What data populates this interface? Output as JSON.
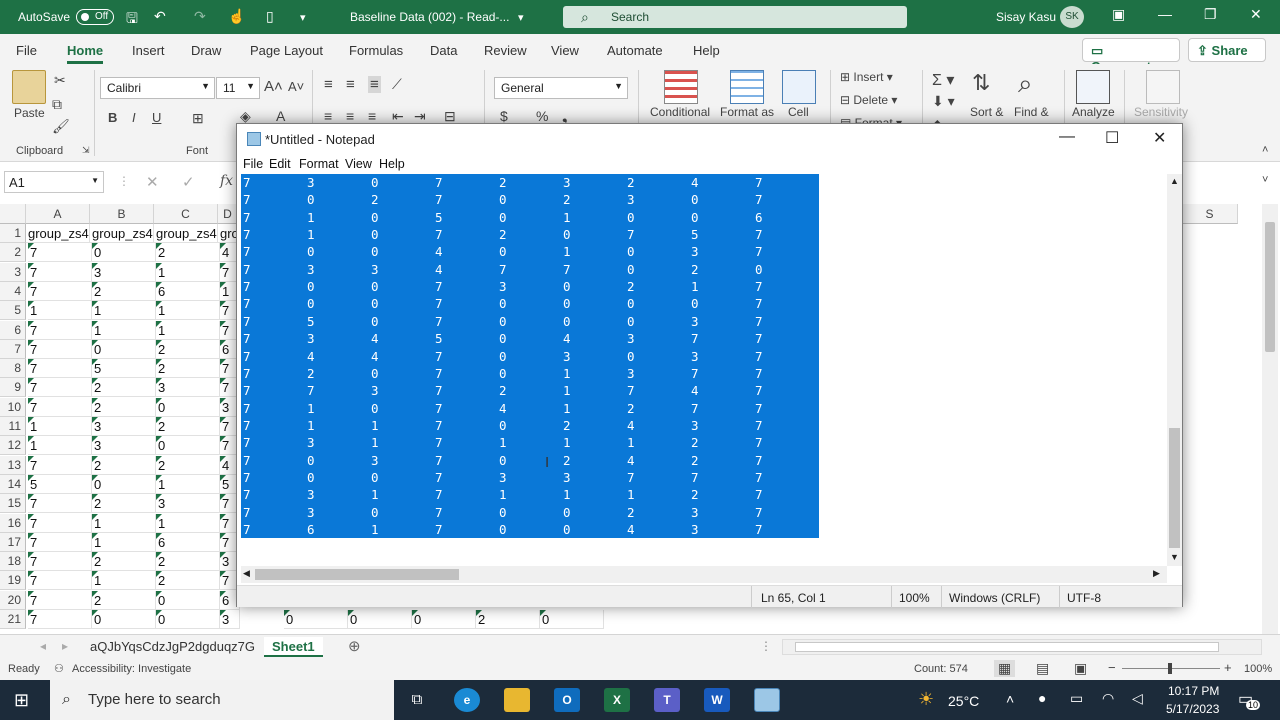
{
  "excel": {
    "autosave_label": "AutoSave",
    "autosave_state": "Off",
    "file_title": "Baseline Data (002)  -  Read-...",
    "search_placeholder": "Search",
    "user_name": "Sisay Kasu",
    "user_initials": "SK",
    "menu": [
      "File",
      "Home",
      "Insert",
      "Draw",
      "Page Layout",
      "Formulas",
      "Data",
      "Review",
      "View",
      "Automate",
      "Help"
    ],
    "active_menu": "Home",
    "comments_label": "Comments",
    "share_label": "Share",
    "ribbon": {
      "paste_label": "Paste",
      "clipboard_label": "Clipboard",
      "font_name": "Calibri",
      "font_size": "11",
      "font_group_label": "Font",
      "number_format": "General",
      "conditional_label": "Conditional",
      "format_as_label": "Format as",
      "cell_label": "Cell",
      "insert_label": "Insert",
      "delete_label": "Delete",
      "format_label": "Format",
      "sort_label": "Sort &",
      "find_label": "Find &",
      "analyze_label": "Analyze",
      "sensitivity_label": "Sensitivity"
    },
    "name_box": "A1",
    "fx_label": "fx",
    "columns": [
      "A",
      "B",
      "C",
      "D"
    ],
    "right_column": "S",
    "rows": [
      [
        "group_zs4",
        "group_zs4",
        "group_zs4",
        "gro"
      ],
      [
        "7",
        "0",
        "2",
        "4"
      ],
      [
        "7",
        "3",
        "1",
        "7"
      ],
      [
        "7",
        "2",
        "6",
        "1"
      ],
      [
        "1",
        "1",
        "1",
        "7"
      ],
      [
        "7",
        "1",
        "1",
        "7"
      ],
      [
        "7",
        "0",
        "2",
        "6"
      ],
      [
        "7",
        "5",
        "2",
        "7"
      ],
      [
        "7",
        "2",
        "3",
        "7"
      ],
      [
        "7",
        "2",
        "0",
        "3"
      ],
      [
        "1",
        "3",
        "2",
        "7"
      ],
      [
        "1",
        "3",
        "0",
        "7"
      ],
      [
        "7",
        "2",
        "2",
        "4"
      ],
      [
        "5",
        "0",
        "1",
        "5"
      ],
      [
        "7",
        "2",
        "3",
        "7"
      ],
      [
        "7",
        "1",
        "1",
        "7"
      ],
      [
        "7",
        "1",
        "6",
        "7"
      ],
      [
        "7",
        "2",
        "2",
        "3"
      ],
      [
        "7",
        "1",
        "2",
        "7"
      ],
      [
        "7",
        "2",
        "0",
        "6"
      ],
      [
        "7",
        "0",
        "0",
        "3"
      ]
    ],
    "row21_extra": [
      "0",
      "0",
      "0",
      "2",
      "0"
    ],
    "sheet_tabs": [
      "aQJbYqsCdzJgP2dgduqz7G",
      "Sheet1"
    ],
    "active_sheet": "Sheet1",
    "status_ready": "Ready",
    "status_accessibility": "Accessibility: Investigate",
    "status_count": "Count: 574",
    "zoom": "100%"
  },
  "notepad": {
    "title": "*Untitled - Notepad",
    "menu": [
      "File",
      "Edit",
      "Format",
      "View",
      "Help"
    ],
    "rows": [
      [
        "7",
        "3",
        "0",
        "7",
        "2",
        "3",
        "2",
        "4",
        "7"
      ],
      [
        "7",
        "0",
        "2",
        "7",
        "0",
        "2",
        "3",
        "0",
        "7"
      ],
      [
        "7",
        "1",
        "0",
        "5",
        "0",
        "1",
        "0",
        "0",
        "6"
      ],
      [
        "7",
        "1",
        "0",
        "7",
        "2",
        "0",
        "7",
        "5",
        "7"
      ],
      [
        "7",
        "0",
        "0",
        "4",
        "0",
        "1",
        "0",
        "3",
        "7"
      ],
      [
        "7",
        "3",
        "3",
        "4",
        "7",
        "7",
        "0",
        "2",
        "0"
      ],
      [
        "7",
        "0",
        "0",
        "7",
        "3",
        "0",
        "2",
        "1",
        "7"
      ],
      [
        "7",
        "0",
        "0",
        "7",
        "0",
        "0",
        "0",
        "0",
        "7"
      ],
      [
        "7",
        "5",
        "0",
        "7",
        "0",
        "0",
        "0",
        "3",
        "7"
      ],
      [
        "7",
        "3",
        "4",
        "5",
        "0",
        "4",
        "3",
        "7",
        "7"
      ],
      [
        "7",
        "4",
        "4",
        "7",
        "0",
        "3",
        "0",
        "3",
        "7"
      ],
      [
        "7",
        "2",
        "0",
        "7",
        "0",
        "1",
        "3",
        "7",
        "7"
      ],
      [
        "7",
        "7",
        "3",
        "7",
        "2",
        "1",
        "7",
        "4",
        "7"
      ],
      [
        "7",
        "1",
        "0",
        "7",
        "4",
        "1",
        "2",
        "7",
        "7"
      ],
      [
        "7",
        "1",
        "1",
        "7",
        "0",
        "2",
        "4",
        "3",
        "7"
      ],
      [
        "7",
        "3",
        "1",
        "7",
        "1",
        "1",
        "1",
        "2",
        "7"
      ],
      [
        "7",
        "0",
        "3",
        "7",
        "0",
        "2",
        "4",
        "2",
        "7"
      ],
      [
        "7",
        "0",
        "0",
        "7",
        "3",
        "3",
        "7",
        "7",
        "7"
      ],
      [
        "7",
        "3",
        "1",
        "7",
        "1",
        "1",
        "1",
        "2",
        "7"
      ],
      [
        "7",
        "3",
        "0",
        "7",
        "0",
        "0",
        "2",
        "3",
        "7"
      ],
      [
        "7",
        "6",
        "1",
        "7",
        "0",
        "0",
        "4",
        "3",
        "7"
      ]
    ],
    "status_position": "Ln 65, Col 1",
    "status_zoom": "100%",
    "status_eol": "Windows (CRLF)",
    "status_encoding": "UTF-8"
  },
  "taskbar": {
    "search_placeholder": "Type here to search",
    "temperature": "25°C",
    "time": "10:17 PM",
    "date": "5/17/2023",
    "notification_count": "10"
  }
}
